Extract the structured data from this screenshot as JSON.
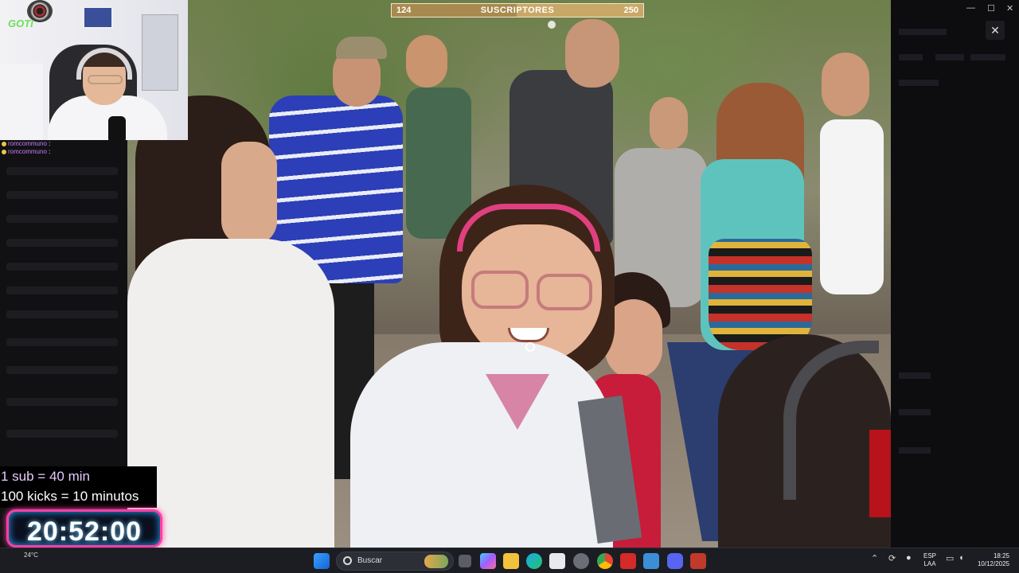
{
  "subs_bar": {
    "current": "124",
    "label": "SUSCRIPTORES",
    "goal": "250",
    "progress": 0.496
  },
  "webcam": {
    "logo": "GOTI"
  },
  "chat": {
    "lines": [
      {
        "user": "romcommuno",
        "message": ":"
      },
      {
        "user": "romcommuno",
        "message": ":"
      }
    ]
  },
  "overlay": {
    "rule_sub": "1 sub = 40 min",
    "rule_kicks": "100 kicks = 10 minutos",
    "timer": "20:52:00"
  },
  "window": {
    "minimize": "—",
    "maximize": "☐",
    "close": "✕",
    "close_button": "✕"
  },
  "taskbar": {
    "weather": "24°C",
    "search_placeholder": "Buscar",
    "lang_top": "ESP",
    "lang_bottom": "LAA",
    "time": "18:25",
    "date": "10/12/2025",
    "apps": [
      "task-view",
      "copilot",
      "file-explorer",
      "edge",
      "store",
      "settings",
      "chrome",
      "red-app",
      "files",
      "discord",
      "tool-app"
    ],
    "tray": [
      "chevron-up-icon",
      "refresh-icon",
      "mic-icon",
      "monitor-icon",
      "wifi-icon",
      "volume-icon"
    ]
  },
  "colors": {
    "timer_border": "#ff3fa4",
    "subbar": "#c9a766",
    "rule_sub": "#e6c9ff"
  }
}
